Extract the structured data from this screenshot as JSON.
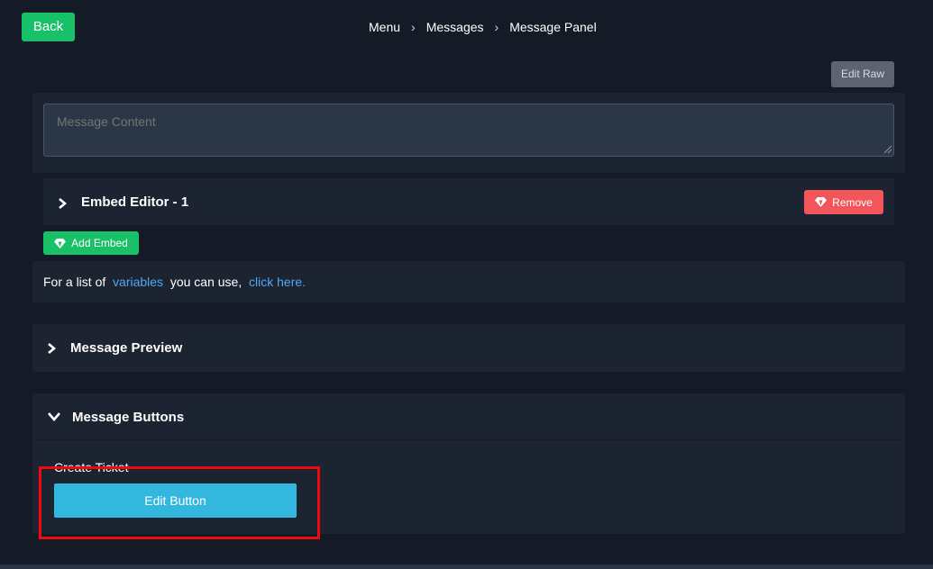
{
  "header": {
    "back_label": "Back",
    "breadcrumb": [
      "Menu",
      "Messages",
      "Message Panel"
    ]
  },
  "toolbar": {
    "edit_raw_label": "Edit Raw"
  },
  "message_content": {
    "placeholder": "Message Content",
    "value": ""
  },
  "embed": {
    "title": "Embed Editor -  1",
    "remove_label": "Remove",
    "add_label": "Add Embed",
    "icon": "gem-icon"
  },
  "variables": {
    "prefix": "For a list of",
    "variables_link": "variables",
    "middle": "you can use,",
    "click_link": "click here."
  },
  "preview": {
    "title": "Message Preview",
    "expanded": false
  },
  "buttons_section": {
    "title": "Message Buttons",
    "expanded": true,
    "items": [
      {
        "label": "Create Ticket",
        "edit_label": "Edit Button"
      }
    ]
  },
  "colors": {
    "background": "#141b26",
    "panel": "#1c2331",
    "green": "#18c167",
    "red": "#f2555a",
    "cyan": "#33b7df",
    "link": "#52a8f2",
    "highlight": "#ee0b0b"
  }
}
